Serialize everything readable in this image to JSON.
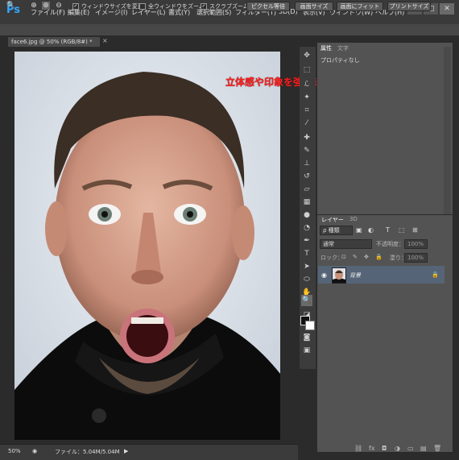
{
  "app": {
    "logo": "Ps"
  },
  "menu": [
    "ファイル(F)",
    "編集(E)",
    "イメージ(I)",
    "レイヤー(L)",
    "書式(Y)",
    "選択範囲(S)",
    "フィルター(T)",
    "3D(D)",
    "表示(V)",
    "ウィンドウ(W)",
    "ヘルプ(H)"
  ],
  "window_buttons": [
    "−",
    "□",
    "✕"
  ],
  "options": {
    "resize_window": "ウィンドウサイズを変更",
    "zoom_all": "全ウィンドウをズーム",
    "scrubby_zoom": "スクラブズーム",
    "btn_pixel": "ピクセル等倍",
    "btn_fit_screen": "画面サイズ",
    "btn_fill_screen": "画面にフィット",
    "btn_print": "プリントサイズ"
  },
  "document": {
    "tab_title": "face6.jpg @ 50% (RGB/8#) *",
    "close": "×"
  },
  "status": {
    "zoom": "50%",
    "file_info": "ファイル：5.04M/5.04M"
  },
  "annotation": "立体感や印象を強める",
  "properties": {
    "tab1": "属性",
    "tab2": "文字",
    "content": "プロパティなし"
  },
  "layers": {
    "tab1": "レイヤー",
    "tab2": "3D",
    "filter": "種類",
    "blend": "通常",
    "opacity_label": "不透明度：",
    "opacity_value": "100%",
    "lock_label": "ロック：",
    "fill_label": "塗り：",
    "fill_value": "100%",
    "layer_name": "背景"
  },
  "icons": [
    "zoom-in-icon",
    "zoom-out-icon",
    "move-icon",
    "marquee-icon",
    "lasso-icon",
    "magic-wand-icon",
    "crop-icon",
    "eyedropper-icon",
    "healing-brush-icon",
    "brush-icon",
    "clone-stamp-icon",
    "history-brush-icon",
    "eraser-icon",
    "gradient-icon",
    "blur-icon",
    "dodge-icon",
    "pen-icon",
    "type-icon",
    "path-select-icon",
    "shape-icon",
    "hand-icon",
    "zoom-tool-icon",
    "color-swatch-icon",
    "quickmask-icon",
    "screen-mode-icon"
  ],
  "colors": {
    "annotation": "#ff1f1f",
    "accent": "#31a8ff",
    "selected_layer": "#556577"
  }
}
